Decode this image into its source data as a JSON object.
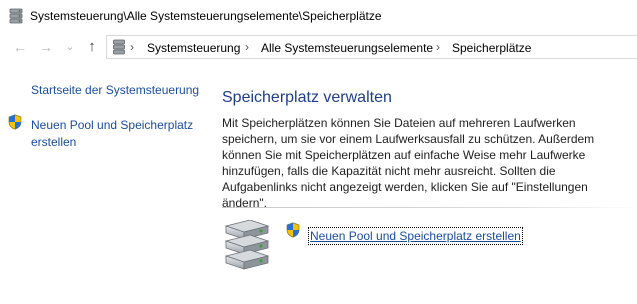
{
  "window": {
    "title": "Systemsteuerung\\Alle Systemsteuerungselemente\\Speicherplätze",
    "icon": "storage-drive-icon"
  },
  "nav": {
    "back_icon": "←",
    "forward_icon": "→",
    "dropdown_icon": "⌄",
    "up_icon": "↑"
  },
  "address": {
    "crumbs": [
      "Systemsteuerung",
      "Alle Systemsteuerungselemente",
      "Speicherplätze"
    ],
    "separator": "›"
  },
  "sidebar": {
    "home_link": "Startseite der Systemsteuerung",
    "create_pool_link": "Neuen Pool und Speicherplatz erstellen"
  },
  "main": {
    "title": "Speicherplatz verwalten",
    "description": "Mit Speicherplätzen können Sie Dateien auf mehreren Laufwerken speichern, um sie vor einem Laufwerksausfall zu schützen. Außerdem können Sie mit Speicherplätzen auf einfache Weise mehr Laufwerke hinzufügen, falls die Kapazität nicht mehr ausreicht. Sollten die Aufgabenlinks nicht angezeigt werden, klicken Sie auf \"Einstellungen ändern\".",
    "create_link": "Neuen Pool und Speicherplatz erstellen"
  },
  "colors": {
    "link": "#1a4d9c",
    "heading": "#1f3e8a",
    "shield_blue": "#2a6fd6",
    "shield_yellow": "#f2c300"
  }
}
